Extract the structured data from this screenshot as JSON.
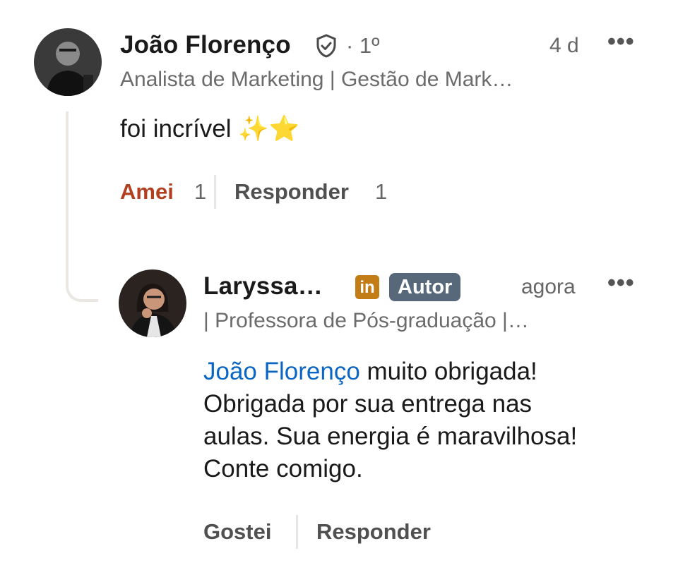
{
  "comment": {
    "author": "João Florenço",
    "degree": "· 1º",
    "time": "4 d",
    "headline": "Analista de Marketing | Gestão de Mark…",
    "text": "foi incrível ✨⭐",
    "reaction_label": "Amei",
    "reaction_count": "1",
    "reply_label": "Responder",
    "reply_count": "1",
    "verified_icon": "shield-check-icon",
    "more_icon": "more-horizontal-icon"
  },
  "reply": {
    "author": "Laryssa…",
    "li_badge": "in",
    "badge": "Autor",
    "time": "agora",
    "headline": "| Professora de Pós-graduação |…",
    "mention": "João Florenço",
    "text_line1_rest": " muito obrigada!",
    "text_line2": "Obrigada por sua entrega nas",
    "text_line3": "aulas. Sua energia é maravilhosa!",
    "text_line4": "Conte comigo.",
    "like_label": "Gostei",
    "reply_label": "Responder",
    "more_icon": "more-horizontal-icon"
  },
  "colors": {
    "mention": "#0a66c2",
    "loved": "#b24020",
    "autor_badge": "#56687a",
    "linkedin_premium": "#c37d16"
  }
}
